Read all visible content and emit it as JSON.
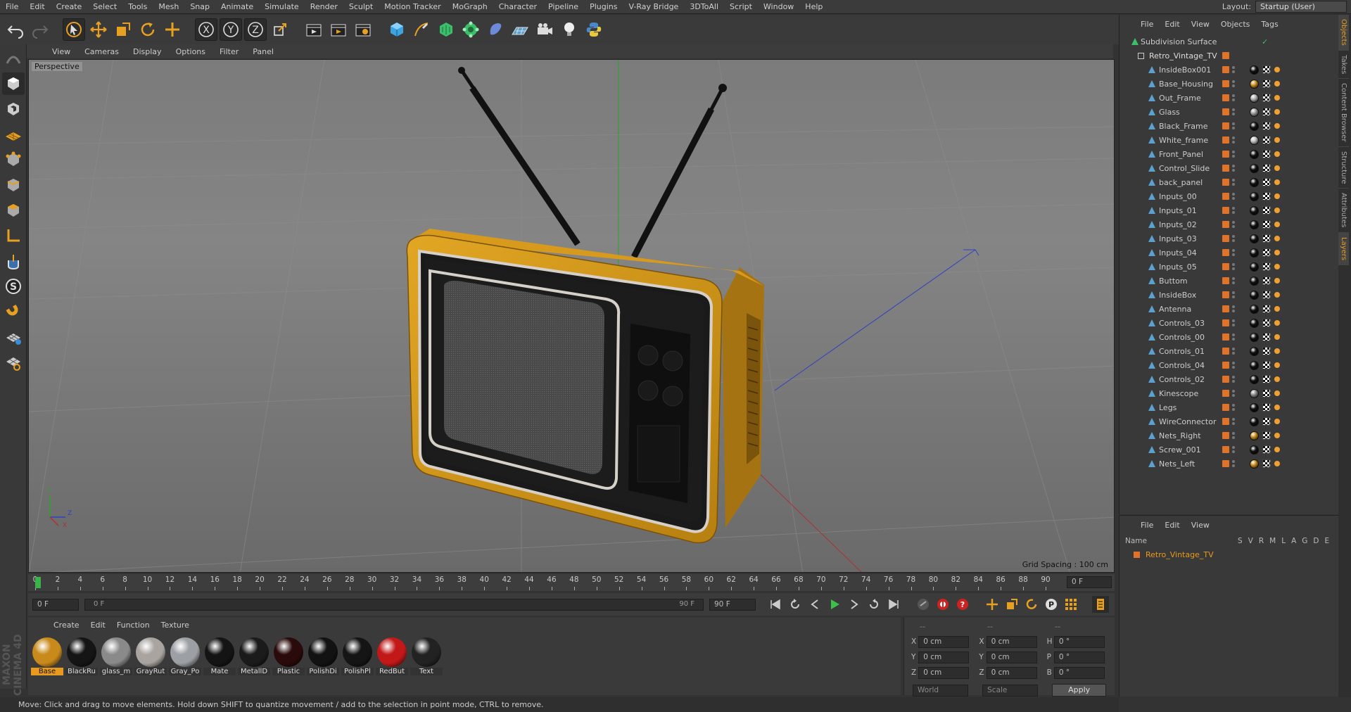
{
  "menu": [
    "File",
    "Edit",
    "Create",
    "Select",
    "Tools",
    "Mesh",
    "Snap",
    "Animate",
    "Simulate",
    "Render",
    "Sculpt",
    "Motion Tracker",
    "MoGraph",
    "Character",
    "Pipeline",
    "Plugins",
    "V-Ray Bridge",
    "3DToAll",
    "Script",
    "Window",
    "Help"
  ],
  "layout": {
    "label": "Layout:",
    "value": "Startup (User)"
  },
  "viewport": {
    "menu": [
      "View",
      "Cameras",
      "Display",
      "Options",
      "Filter",
      "Panel"
    ],
    "label": "Perspective",
    "grid_spacing": "Grid Spacing : 100 cm"
  },
  "timeline": {
    "ticks": [
      "0",
      "2",
      "4",
      "6",
      "8",
      "10",
      "12",
      "14",
      "16",
      "18",
      "20",
      "22",
      "24",
      "26",
      "28",
      "30",
      "32",
      "34",
      "36",
      "38",
      "40",
      "42",
      "44",
      "46",
      "48",
      "50",
      "52",
      "54",
      "56",
      "58",
      "60",
      "62",
      "64",
      "66",
      "68",
      "70",
      "72",
      "74",
      "76",
      "78",
      "80",
      "82",
      "84",
      "86",
      "88",
      "90"
    ],
    "current_frame": "0 F",
    "start_field": "0 F",
    "range_start": "0 F",
    "range_end": "90 F",
    "end_field": "90 F"
  },
  "materials": {
    "menu": [
      "Create",
      "Edit",
      "Function",
      "Texture"
    ],
    "items": [
      {
        "name": "Base",
        "color": "#c88a1a",
        "selected": true
      },
      {
        "name": "BlackRu",
        "color": "#151515"
      },
      {
        "name": "glass_m",
        "color": "#8a8a8a"
      },
      {
        "name": "GrayRut",
        "color": "#a9a49f"
      },
      {
        "name": "Gray_Po",
        "color": "#9ca0a4"
      },
      {
        "name": "Mate",
        "color": "#141414"
      },
      {
        "name": "MetallD",
        "color": "#1b1b1b"
      },
      {
        "name": "Plastic",
        "color": "#2a0a0a"
      },
      {
        "name": "PolishDi",
        "color": "#121212"
      },
      {
        "name": "PolishPl",
        "color": "#151515"
      },
      {
        "name": "RedBut",
        "color": "#c21818"
      },
      {
        "name": "Text",
        "color": "#222222"
      }
    ]
  },
  "coords": {
    "header": [
      "--",
      "--",
      "--"
    ],
    "rows": [
      {
        "a": "X",
        "av": "0 cm",
        "b": "X",
        "bv": "0 cm",
        "c": "H",
        "cv": "0 °"
      },
      {
        "a": "Y",
        "av": "0 cm",
        "b": "Y",
        "bv": "0 cm",
        "c": "P",
        "cv": "0 °"
      },
      {
        "a": "Z",
        "av": "0 cm",
        "b": "Z",
        "bv": "0 cm",
        "c": "B",
        "cv": "0 °"
      }
    ],
    "world": "World",
    "scale": "Scale",
    "apply": "Apply"
  },
  "status": "Move: Click and drag to move elements. Hold down SHIFT to quantize movement / add to the selection in point mode, CTRL to remove.",
  "objects": {
    "menu": [
      "File",
      "Edit",
      "View",
      "Objects",
      "Tags"
    ],
    "root": "Subdivision Surface",
    "group": "Retro_Vintage_TV",
    "items": [
      {
        "name": "InsideBox001",
        "mat": "#111"
      },
      {
        "name": "Base_Housing",
        "mat": "#c88a1a"
      },
      {
        "name": "Out_Frame",
        "mat": "#aaa"
      },
      {
        "name": "Glass",
        "mat": "#999"
      },
      {
        "name": "Black_Frame",
        "mat": "#111"
      },
      {
        "name": "White_frame",
        "mat": "#bbb"
      },
      {
        "name": "Front_Panel",
        "mat": "#111"
      },
      {
        "name": "Control_Slide",
        "mat": "#111"
      },
      {
        "name": "back_panel",
        "mat": "#111"
      },
      {
        "name": "Inputs_00",
        "mat": "#111"
      },
      {
        "name": "Inputs_01",
        "mat": "#111"
      },
      {
        "name": "Inputs_02",
        "mat": "#111"
      },
      {
        "name": "Inputs_03",
        "mat": "#111"
      },
      {
        "name": "Inputs_04",
        "mat": "#111"
      },
      {
        "name": "Inputs_05",
        "mat": "#111"
      },
      {
        "name": "Buttom",
        "mat": "#111"
      },
      {
        "name": "InsideBox",
        "mat": "#111"
      },
      {
        "name": "Antenna",
        "mat": "#111"
      },
      {
        "name": "Controls_03",
        "mat": "#111"
      },
      {
        "name": "Controls_00",
        "mat": "#111"
      },
      {
        "name": "Controls_01",
        "mat": "#111"
      },
      {
        "name": "Controls_04",
        "mat": "#111"
      },
      {
        "name": "Controls_02",
        "mat": "#111"
      },
      {
        "name": "Kinescope",
        "mat": "#888"
      },
      {
        "name": "Legs",
        "mat": "#111"
      },
      {
        "name": "WireConnector",
        "mat": "#111"
      },
      {
        "name": "Nets_Right",
        "mat": "#c88a1a"
      },
      {
        "name": "Screw_001",
        "mat": "#111"
      },
      {
        "name": "Nets_Left",
        "mat": "#c88a1a"
      }
    ]
  },
  "layers": {
    "menu": [
      "File",
      "Edit",
      "View"
    ],
    "header_name": "Name",
    "header_cols": [
      "S",
      "V",
      "R",
      "M",
      "L",
      "A",
      "G",
      "D",
      "E"
    ],
    "item": "Retro_Vintage_TV"
  },
  "sidetabs": [
    "Objects",
    "Takes",
    "Content Browser",
    "Structure",
    "Attributes",
    "Layers"
  ]
}
